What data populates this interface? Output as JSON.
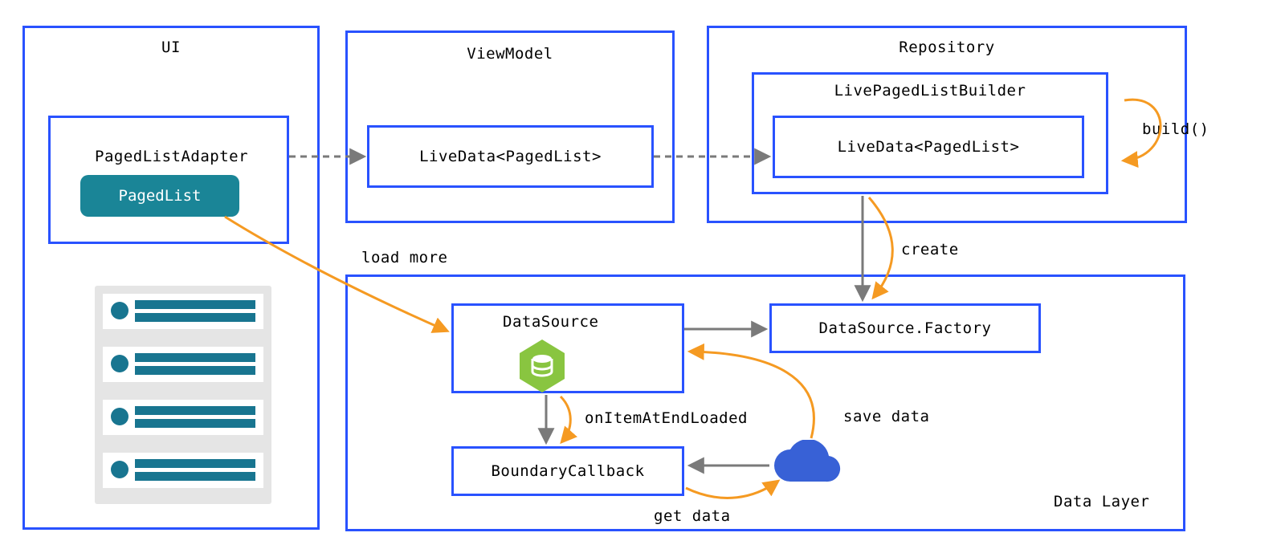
{
  "columns": {
    "ui": {
      "title": "UI",
      "adapter_label": "PagedListAdapter",
      "pagedlist_label": "PagedList"
    },
    "viewmodel": {
      "title": "ViewModel",
      "livedata_label": "LiveData<PagedList>"
    },
    "repository": {
      "title": "Repository",
      "builder_label": "LivePagedListBuilder",
      "livedata_label": "LiveData<PagedList>",
      "build_label": "build()"
    }
  },
  "datalayer": {
    "title": "Data Layer",
    "datasource_label": "DataSource",
    "factory_label": "DataSource.Factory",
    "boundary_label": "BoundaryCallback"
  },
  "arrows": {
    "load_more": "load more",
    "create": "create",
    "on_item_end": "onItemAtEndLoaded",
    "save_data": "save data",
    "get_data": "get data"
  },
  "colors": {
    "box_border": "#2952ff",
    "pill": "#1a8597",
    "orange": "#f59a22",
    "gray": "#7a7a7a",
    "green": "#8bc34a",
    "cloud": "#3861d6",
    "list_bg": "#e5e5e5",
    "list_fg": "#187590"
  }
}
